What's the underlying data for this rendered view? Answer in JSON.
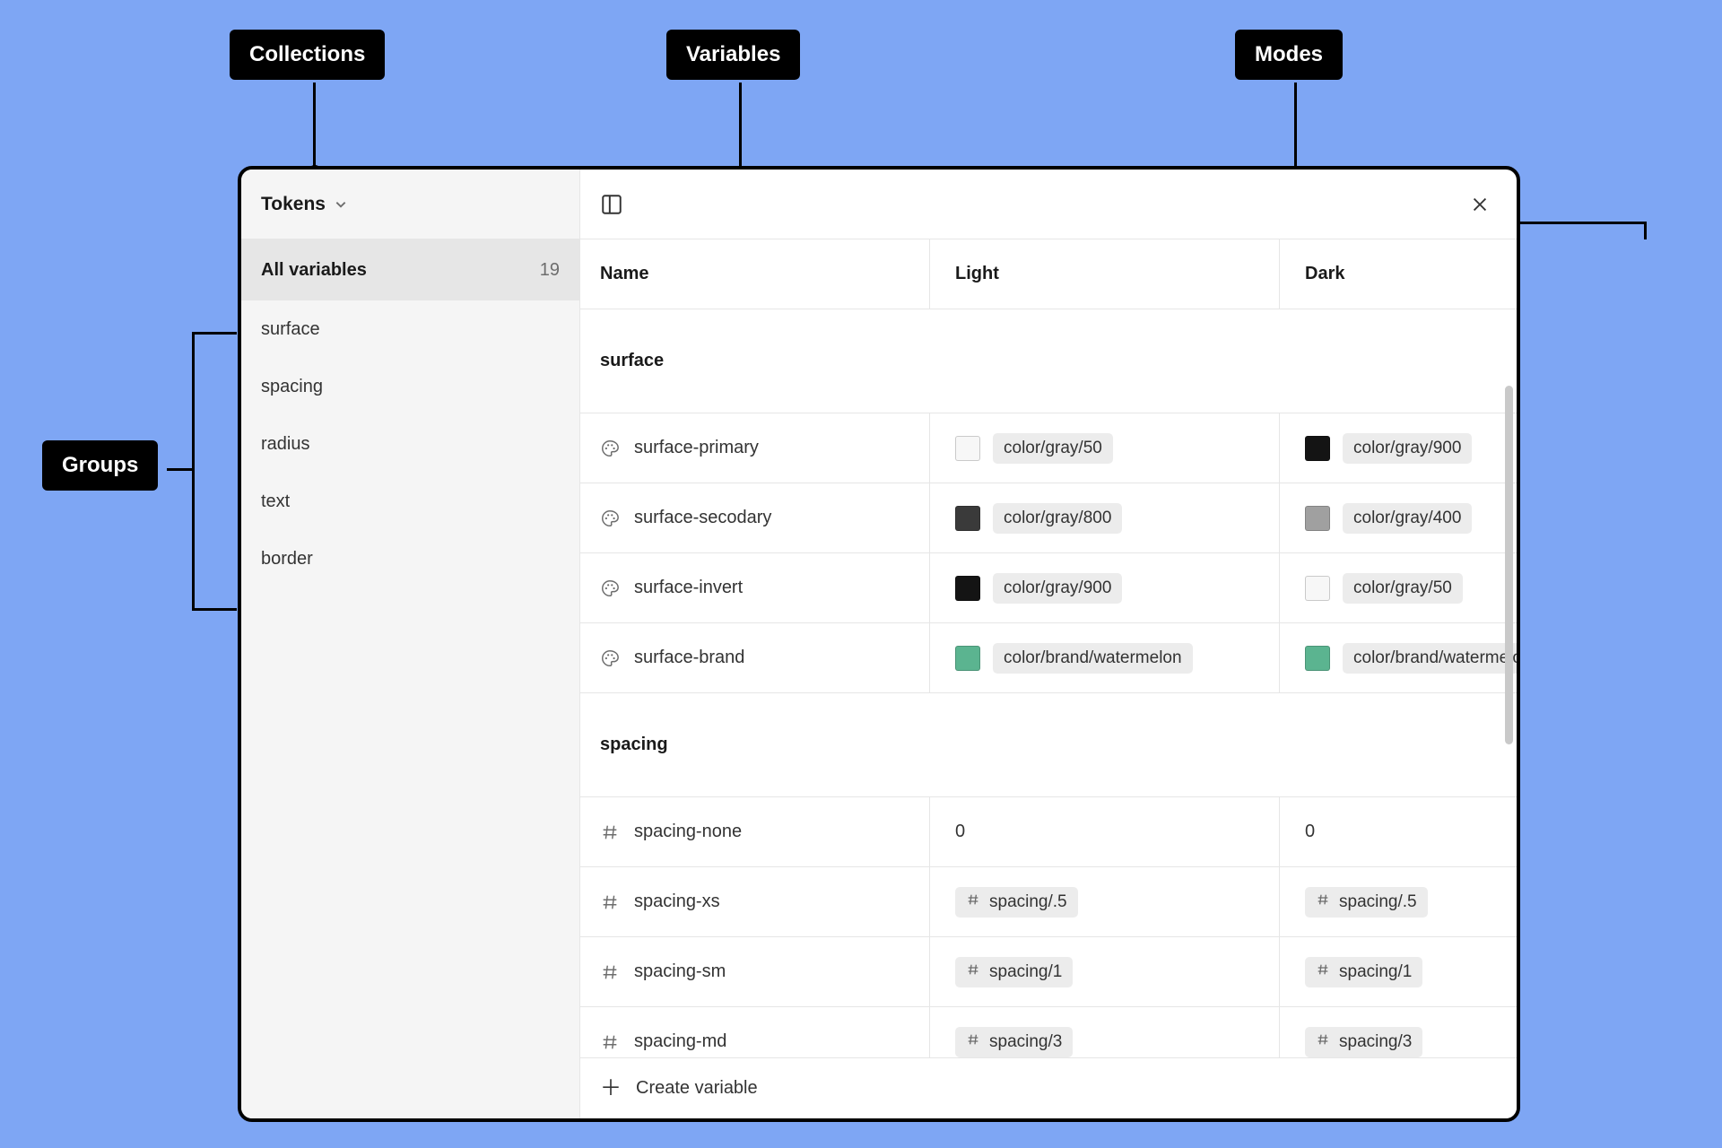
{
  "callouts": {
    "collections": "Collections",
    "variables": "Variables",
    "modes": "Modes",
    "groups": "Groups"
  },
  "sidebar": {
    "collection": "Tokens",
    "all_label": "All variables",
    "all_count": "19",
    "groups": [
      {
        "label": "surface"
      },
      {
        "label": "spacing"
      },
      {
        "label": "radius"
      },
      {
        "label": "text"
      },
      {
        "label": "border"
      }
    ]
  },
  "columns": {
    "name": "Name",
    "modes": [
      "Light",
      "Dark"
    ]
  },
  "groups": [
    {
      "title": "surface",
      "type": "color",
      "rows": [
        {
          "name": "surface-primary",
          "values": [
            {
              "swatch": "#f7f7f7",
              "label": "color/gray/50"
            },
            {
              "swatch": "#141414",
              "label": "color/gray/900"
            }
          ]
        },
        {
          "name": "surface-secodary",
          "values": [
            {
              "swatch": "#3a3a3a",
              "label": "color/gray/800"
            },
            {
              "swatch": "#a0a0a0",
              "label": "color/gray/400"
            }
          ]
        },
        {
          "name": "surface-invert",
          "values": [
            {
              "swatch": "#141414",
              "label": "color/gray/900"
            },
            {
              "swatch": "#f7f7f7",
              "label": "color/gray/50"
            }
          ]
        },
        {
          "name": "surface-brand",
          "values": [
            {
              "swatch": "#5bb490",
              "label": "color/brand/watermelon"
            },
            {
              "swatch": "#5bb490",
              "label": "color/brand/watermelon"
            }
          ]
        }
      ]
    },
    {
      "title": "spacing",
      "type": "number",
      "rows": [
        {
          "name": "spacing-none",
          "values": [
            {
              "raw": "0"
            },
            {
              "raw": "0"
            }
          ]
        },
        {
          "name": "spacing-xs",
          "values": [
            {
              "alias": "spacing/.5"
            },
            {
              "alias": "spacing/.5"
            }
          ]
        },
        {
          "name": "spacing-sm",
          "values": [
            {
              "alias": "spacing/1"
            },
            {
              "alias": "spacing/1"
            }
          ]
        },
        {
          "name": "spacing-md",
          "values": [
            {
              "alias": "spacing/3"
            },
            {
              "alias": "spacing/3"
            }
          ]
        }
      ]
    }
  ],
  "create_label": "Create variable"
}
